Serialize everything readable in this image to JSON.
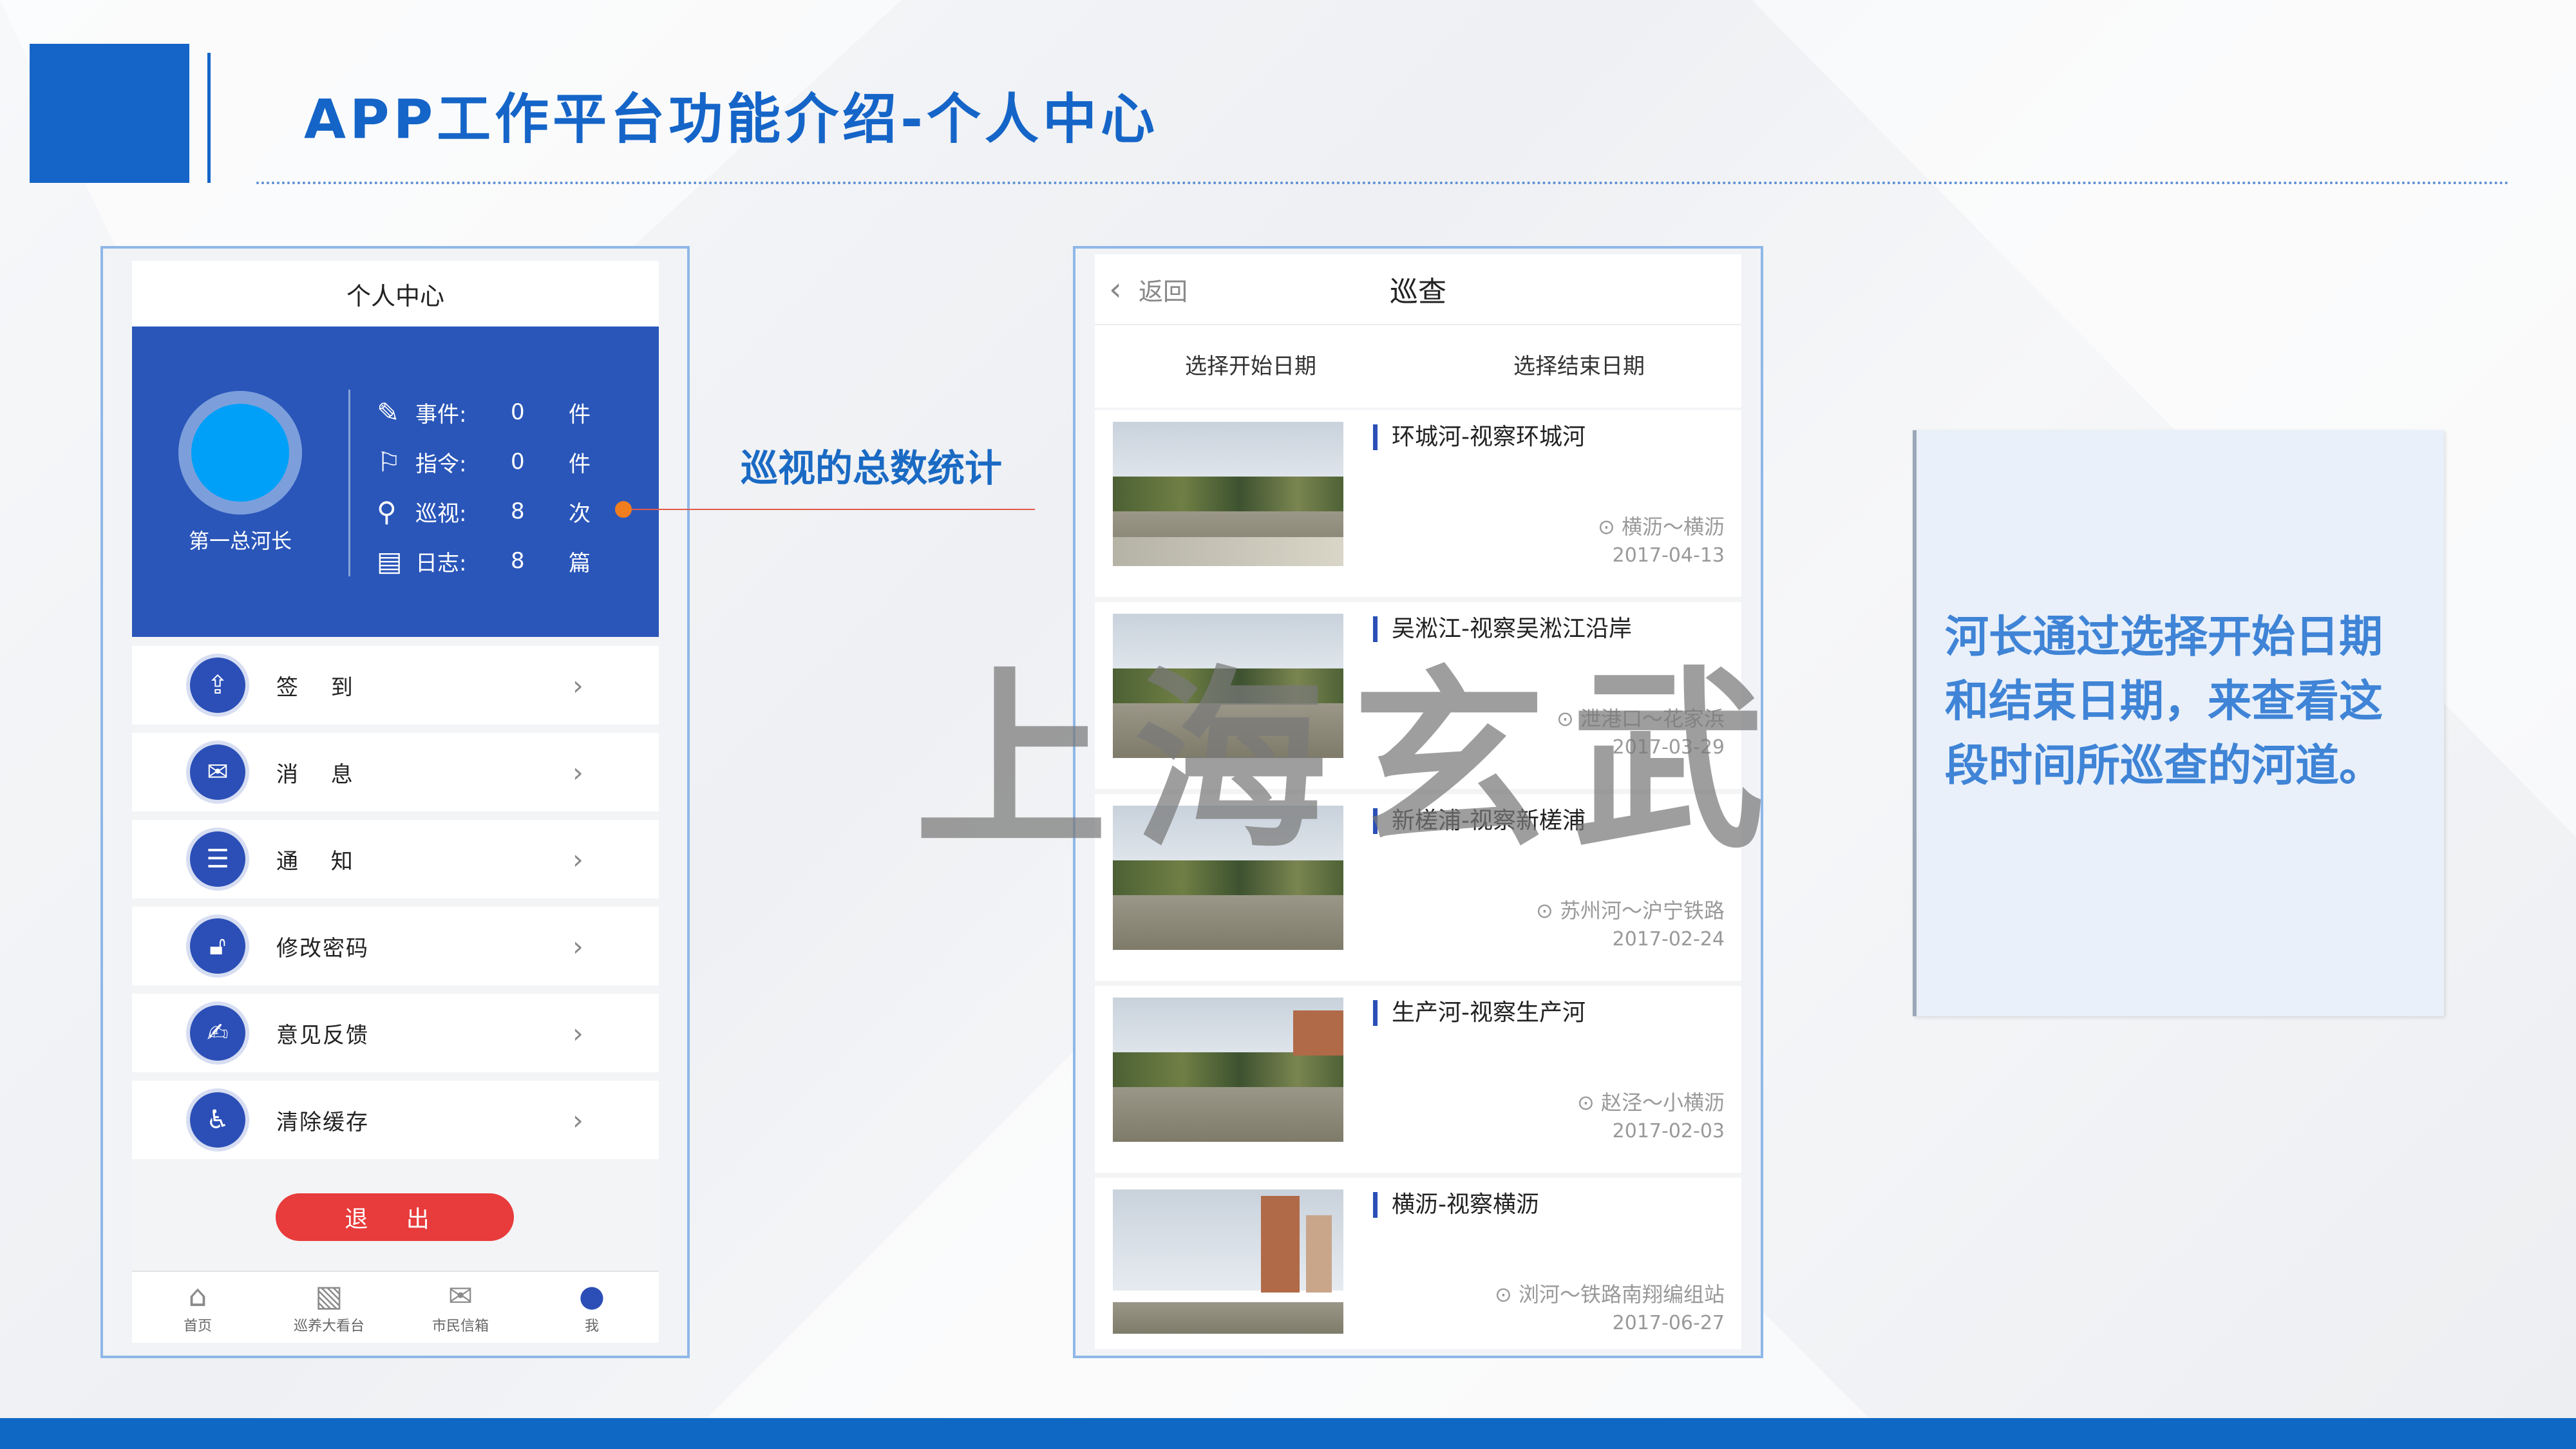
{
  "slide": {
    "title": "APP工作平台功能介绍-个人中心",
    "annotation": "巡视的总数统计",
    "description": "河长通过选择开始日期和结束日期，来查看这段时间所巡查的河道。",
    "watermark": "上海玄武",
    "colors": {
      "brand_blue": "#1565c8",
      "panel_blue": "#2a56b9",
      "logout_red": "#e83b3b",
      "accent_orange": "#f07d1e"
    }
  },
  "profile_screen": {
    "header": "个人中心",
    "user_name": "第一总河长",
    "stats": [
      {
        "icon": "edit-icon",
        "label": "事件:",
        "value": "0",
        "unit": "件"
      },
      {
        "icon": "flag-icon",
        "label": "指令:",
        "value": "0",
        "unit": "件"
      },
      {
        "icon": "person-location-icon",
        "label": "巡视:",
        "value": "8",
        "unit": "次"
      },
      {
        "icon": "log-icon",
        "label": "日志:",
        "value": "8",
        "unit": "篇"
      }
    ],
    "menu": [
      {
        "icon": "checkin-icon",
        "label": "签　 到"
      },
      {
        "icon": "message-icon",
        "label": "消　 息"
      },
      {
        "icon": "notice-icon",
        "label": "通　 知"
      },
      {
        "icon": "lock-icon",
        "label": "修改密码"
      },
      {
        "icon": "feedback-icon",
        "label": "意见反馈"
      },
      {
        "icon": "clear-cache-icon",
        "label": "清除缓存"
      }
    ],
    "logout_label": "退 出",
    "tabs": [
      {
        "icon": "home-icon",
        "label": "首页"
      },
      {
        "icon": "dashboard-icon",
        "label": "巡养大看台"
      },
      {
        "icon": "mail-icon",
        "label": "市民信箱"
      },
      {
        "icon": "user-icon",
        "label": "我"
      }
    ]
  },
  "patrol_screen": {
    "back_label": "返回",
    "title": "巡查",
    "start_date_label": "选择开始日期",
    "end_date_label": "选择结束日期",
    "items": [
      {
        "title": "环城河-视察环城河",
        "location": "横沥～横沥",
        "date": "2017-04-13"
      },
      {
        "title": "吴淞江-视察吴淞江沿岸",
        "location": "泄港口～花家浜",
        "date": "2017-03-29"
      },
      {
        "title": "新槎浦-视察新槎浦",
        "location": "苏州河～沪宁铁路",
        "date": "2017-02-24"
      },
      {
        "title": "生产河-视察生产河",
        "location": "赵泾～小横沥",
        "date": "2017-02-03"
      },
      {
        "title": "横沥-视察横沥",
        "location": "浏河～铁路南翔编组站",
        "date": "2017-06-27"
      }
    ]
  }
}
